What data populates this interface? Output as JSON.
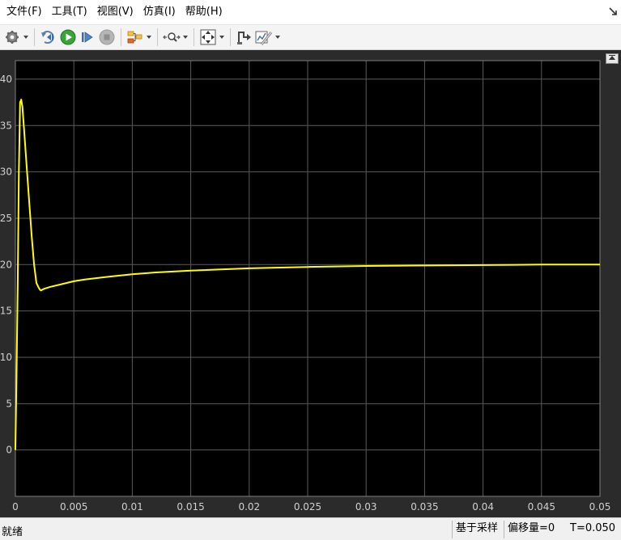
{
  "menu": {
    "items": [
      "文件(F)",
      "工具(T)",
      "视图(V)",
      "仿真(I)",
      "帮助(H)"
    ]
  },
  "toolbar": {
    "buttons": [
      "settings-icon",
      "step-back-icon",
      "run-icon",
      "step-forward-icon",
      "stop-icon",
      "highlight-model-icon",
      "zoom-icon",
      "fit-to-view-icon",
      "cursor-measurements-icon",
      "signal-statistics-icon"
    ]
  },
  "status": {
    "ready": "就绪",
    "sample_based": "基于采样",
    "offset": "偏移量=0",
    "time": "T=0.050"
  },
  "colors": {
    "plot_background": "#000000",
    "frame_background": "#2b2b2b",
    "grid": "#5a5a5a",
    "trace": "#ffff00",
    "tick_label": "#d0d0d0"
  },
  "chart_data": {
    "type": "line",
    "title": "",
    "xlabel": "",
    "ylabel": "",
    "xlim": [
      0,
      0.05
    ],
    "ylim": [
      -5,
      42
    ],
    "grid": true,
    "xticks": [
      "0",
      "0.005",
      "0.01",
      "0.015",
      "0.02",
      "0.025",
      "0.03",
      "0.035",
      "0.04",
      "0.045",
      "0.05"
    ],
    "yticks": [
      "0",
      "5",
      "10",
      "15",
      "20",
      "25",
      "30",
      "35",
      "40"
    ],
    "series": [
      {
        "color": "#ffff00",
        "x": [
          0,
          0.0001,
          0.0002,
          0.0003,
          0.0004,
          0.0005,
          0.0006,
          0.0008,
          0.001,
          0.0012,
          0.0014,
          0.0016,
          0.0018,
          0.002,
          0.0021,
          0.0022,
          0.0023,
          0.0025,
          0.003,
          0.004,
          0.005,
          0.006,
          0.008,
          0.01,
          0.012,
          0.015,
          0.02,
          0.025,
          0.03,
          0.035,
          0.04,
          0.045,
          0.05
        ],
        "y": [
          0,
          8,
          18,
          30,
          37.5,
          37.8,
          37,
          33.5,
          30,
          26.5,
          23,
          20,
          18,
          17.5,
          17.3,
          17.2,
          17.3,
          17.4,
          17.6,
          17.9,
          18.2,
          18.4,
          18.7,
          18.95,
          19.15,
          19.35,
          19.6,
          19.75,
          19.85,
          19.9,
          19.95,
          20,
          20
        ]
      }
    ]
  }
}
